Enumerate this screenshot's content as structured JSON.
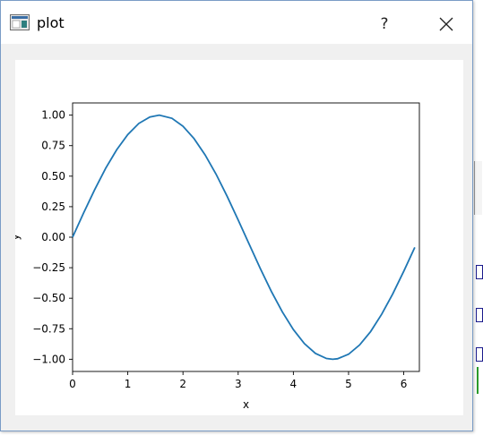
{
  "window": {
    "title": "plot",
    "help_label": "?",
    "icons": {
      "app": "plot-window-icon",
      "close": "close-icon"
    }
  },
  "chart_data": {
    "type": "line",
    "function": "sin(x)",
    "title": "",
    "xlabel": "x",
    "ylabel": "y",
    "xlim": [
      0,
      6.283
    ],
    "ylim": [
      -1.1,
      1.1
    ],
    "xticks": [
      "0",
      "1",
      "2",
      "3",
      "4",
      "5",
      "6"
    ],
    "yticks": [
      "1.00",
      "0.75",
      "0.50",
      "0.25",
      "0.00",
      "−0.25",
      "−0.50",
      "−0.75",
      "−1.00"
    ],
    "grid": false,
    "series": [
      {
        "color": "#1f77b4",
        "x": [
          0,
          0.2,
          0.4,
          0.6,
          0.8,
          1.0,
          1.2,
          1.4,
          1.571,
          1.8,
          2.0,
          2.2,
          2.4,
          2.6,
          2.8,
          3.0,
          3.2,
          3.4,
          3.6,
          3.8,
          4.0,
          4.2,
          4.4,
          4.6,
          4.712,
          4.8,
          5.0,
          5.2,
          5.4,
          5.6,
          5.8,
          6.0,
          6.2
        ],
        "y": [
          0,
          0.199,
          0.389,
          0.565,
          0.717,
          0.841,
          0.932,
          0.985,
          1.0,
          0.974,
          0.909,
          0.808,
          0.675,
          0.516,
          0.335,
          0.141,
          -0.058,
          -0.256,
          -0.443,
          -0.612,
          -0.757,
          -0.872,
          -0.952,
          -0.994,
          -1.0,
          -0.996,
          -0.959,
          -0.883,
          -0.773,
          -0.631,
          -0.465,
          -0.279,
          -0.083
        ]
      }
    ]
  }
}
